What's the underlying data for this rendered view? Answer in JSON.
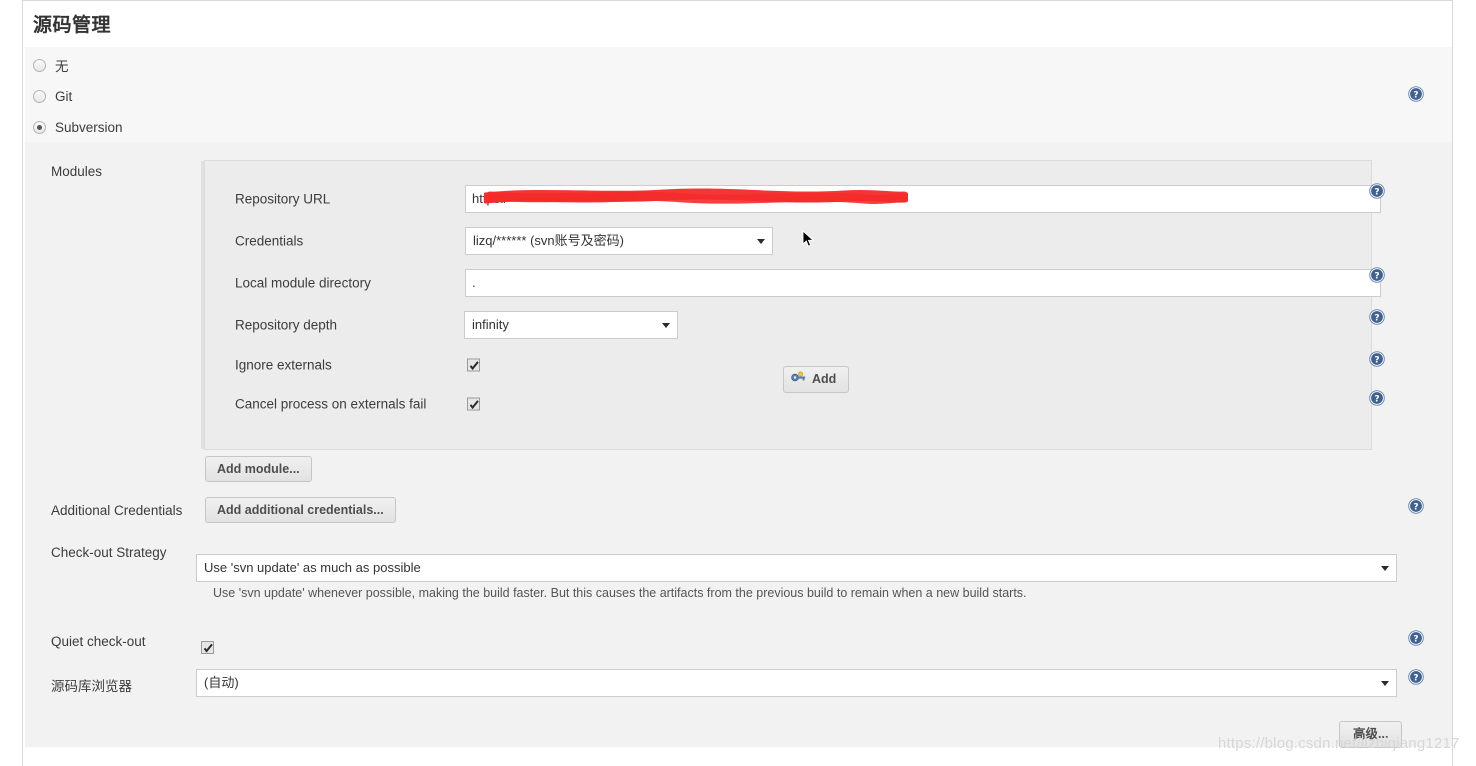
{
  "page": {
    "title": "源码管理",
    "watermark": "https://blog.csdn.net/lizhiqiang1217"
  },
  "scm_options": [
    {
      "label": "无",
      "selected": false
    },
    {
      "label": "Git",
      "selected": false
    },
    {
      "label": "Subversion",
      "selected": true
    }
  ],
  "modules": {
    "label": "Modules",
    "fields": {
      "repository_url": {
        "label": "Repository URL",
        "value": "https:/",
        "redacted": true
      },
      "credentials": {
        "label": "Credentials",
        "value": "lizq/****** (svn账号及密码)"
      },
      "add_credentials_button": "Add",
      "local_module_directory": {
        "label": "Local module directory",
        "value": "."
      },
      "repository_depth": {
        "label": "Repository depth",
        "value": "infinity"
      },
      "ignore_externals": {
        "label": "Ignore externals",
        "checked": true
      },
      "cancel_process_on_externals_fail": {
        "label": "Cancel process on externals fail",
        "checked": true
      }
    },
    "add_module_button": "Add module..."
  },
  "additional_credentials": {
    "label": "Additional Credentials",
    "button": "Add additional credentials..."
  },
  "checkout_strategy": {
    "label": "Check-out Strategy",
    "value": "Use 'svn update' as much as possible",
    "description": "Use 'svn update' whenever possible, making the build faster. But this causes the artifacts from the previous build to remain when a new build starts."
  },
  "quiet_checkout": {
    "label": "Quiet check-out",
    "checked": true
  },
  "repository_browser": {
    "label": "源码库浏览器",
    "value": "(自动)"
  },
  "advanced_button": "高级...",
  "icons": {
    "help": "help-icon",
    "key": "key-icon",
    "caret": "chevron-down-icon",
    "check": "checkmark-icon",
    "cursor": "mouse-cursor-icon"
  },
  "colors": {
    "help_blue": "#41618f",
    "redaction_red": "#f42b2b",
    "page_bg": "#ffffff",
    "block_bg": "#f2f2f2",
    "panel_bg": "#ececec",
    "radio_bg": "#f7f7f7"
  }
}
